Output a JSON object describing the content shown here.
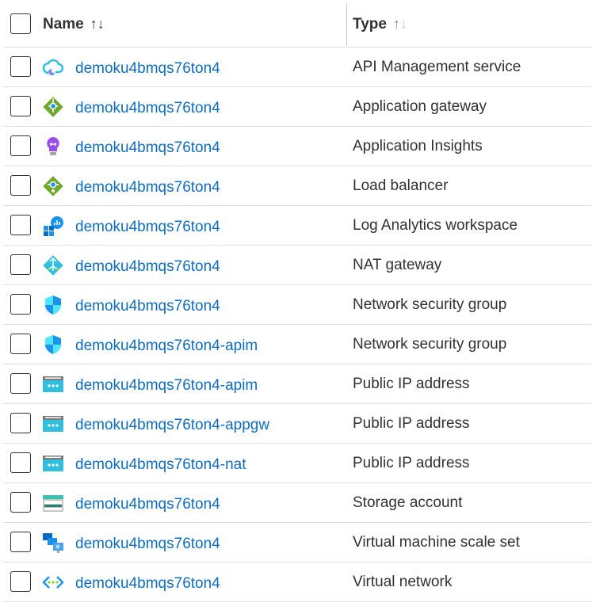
{
  "header": {
    "name_label": "Name",
    "type_label": "Type",
    "sort_up": "↑",
    "sort_down": "↓"
  },
  "rows": [
    {
      "name": "demoku4bmqs76ton4",
      "type": "API Management service",
      "icon": "api-management-icon"
    },
    {
      "name": "demoku4bmqs76ton4",
      "type": "Application gateway",
      "icon": "application-gateway-icon"
    },
    {
      "name": "demoku4bmqs76ton4",
      "type": "Application Insights",
      "icon": "application-insights-icon"
    },
    {
      "name": "demoku4bmqs76ton4",
      "type": "Load balancer",
      "icon": "load-balancer-icon"
    },
    {
      "name": "demoku4bmqs76ton4",
      "type": "Log Analytics workspace",
      "icon": "log-analytics-icon"
    },
    {
      "name": "demoku4bmqs76ton4",
      "type": "NAT gateway",
      "icon": "nat-gateway-icon"
    },
    {
      "name": "demoku4bmqs76ton4",
      "type": "Network security group",
      "icon": "network-security-group-icon"
    },
    {
      "name": "demoku4bmqs76ton4-apim",
      "type": "Network security group",
      "icon": "network-security-group-icon"
    },
    {
      "name": "demoku4bmqs76ton4-apim",
      "type": "Public IP address",
      "icon": "public-ip-icon"
    },
    {
      "name": "demoku4bmqs76ton4-appgw",
      "type": "Public IP address",
      "icon": "public-ip-icon"
    },
    {
      "name": "demoku4bmqs76ton4-nat",
      "type": "Public IP address",
      "icon": "public-ip-icon"
    },
    {
      "name": "demoku4bmqs76ton4",
      "type": "Storage account",
      "icon": "storage-account-icon"
    },
    {
      "name": "demoku4bmqs76ton4",
      "type": "Virtual machine scale set",
      "icon": "vm-scale-set-icon"
    },
    {
      "name": "demoku4bmqs76ton4",
      "type": "Virtual network",
      "icon": "virtual-network-icon"
    }
  ],
  "colors": {
    "link": "#0f6cbd",
    "text": "#323130",
    "border": "#e1dfdd"
  }
}
